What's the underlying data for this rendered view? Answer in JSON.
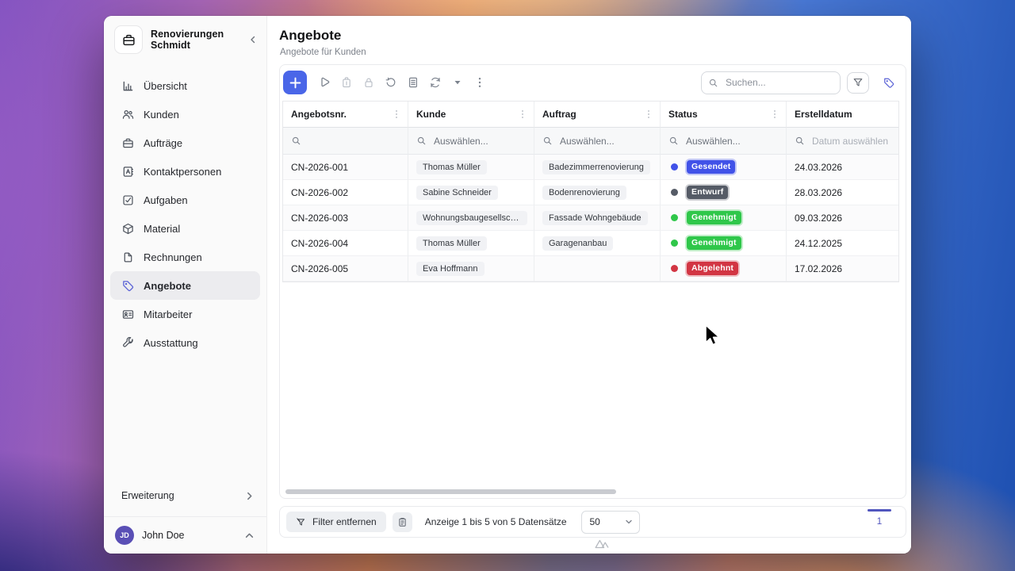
{
  "sidebar": {
    "title": "Renovierungen Schmidt",
    "items": [
      {
        "label": "Übersicht"
      },
      {
        "label": "Kunden"
      },
      {
        "label": "Aufträge"
      },
      {
        "label": "Kontaktpersonen"
      },
      {
        "label": "Aufgaben"
      },
      {
        "label": "Material"
      },
      {
        "label": "Rechnungen"
      },
      {
        "label": "Angebote"
      },
      {
        "label": "Mitarbeiter"
      },
      {
        "label": "Ausstattung"
      }
    ],
    "extension_label": "Erweiterung",
    "user": {
      "initials": "JD",
      "name": "John Doe"
    }
  },
  "header": {
    "title": "Angebote",
    "subtitle": "Angebote für Kunden"
  },
  "toolbar": {
    "add_label": "+",
    "search_placeholder": "Suchen..."
  },
  "table": {
    "columns": [
      {
        "label": "Angebotsnr.",
        "filter_placeholder": ""
      },
      {
        "label": "Kunde",
        "filter_placeholder": "Auswählen..."
      },
      {
        "label": "Auftrag",
        "filter_placeholder": "Auswählen..."
      },
      {
        "label": "Status",
        "filter_placeholder": "Auswählen..."
      },
      {
        "label": "Erstelldatum",
        "filter_placeholder": "Datum auswählen"
      }
    ],
    "rows": [
      {
        "number": "CN-2026-001",
        "customer": "Thomas Müller",
        "order": "Badezimmerrenovierung",
        "status": {
          "label": "Gesendet",
          "color": "#4152e8"
        },
        "date": "24.03.2026"
      },
      {
        "number": "CN-2026-002",
        "customer": "Sabine Schneider",
        "order": "Bodenrenovierung",
        "status": {
          "label": "Entwurf",
          "color": "#555b66"
        },
        "date": "28.03.2026"
      },
      {
        "number": "CN-2026-003",
        "customer": "Wohnungsbaugesellschaft ...",
        "order": "Fassade Wohngebäude",
        "status": {
          "label": "Genehmigt",
          "color": "#2fc74a"
        },
        "date": "09.03.2026"
      },
      {
        "number": "CN-2026-004",
        "customer": "Thomas Müller",
        "order": "Garagenanbau",
        "status": {
          "label": "Genehmigt",
          "color": "#2fc74a"
        },
        "date": "24.12.2025"
      },
      {
        "number": "CN-2026-005",
        "customer": "Eva Hoffmann",
        "order": "",
        "status": {
          "label": "Abgelehnt",
          "color": "#d23543"
        },
        "date": "17.02.2026"
      }
    ]
  },
  "footer": {
    "clear_filter_label": "Filter entfernen",
    "records_text": "Anzeige 1 bis 5 von 5 Datensätze",
    "page_size": "50",
    "page": "1"
  },
  "colors": {
    "accent_blue": "#4a66e8",
    "active_icon": "#5b63d6",
    "avatar_bg": "#5a4fb5",
    "pager_accent": "#5156be"
  }
}
